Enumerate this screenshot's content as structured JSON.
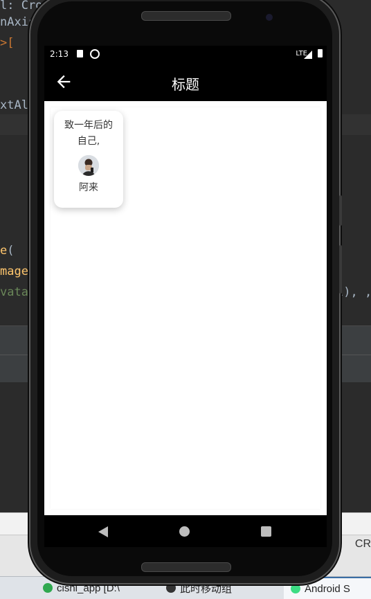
{
  "ide": {
    "code_lines": [
      {
        "parts": [
          {
            "t": "l: CrossAxisAlignment.",
            "c": ""
          }
        ]
      },
      {
        "parts": [
          {
            "t": "nAxisS",
            "c": ""
          }
        ]
      },
      {
        "parts": [
          {
            "t": ">[",
            "c": ""
          }
        ]
      },
      {
        "parts": [
          {
            "t": "xtAli",
            "c": ""
          }
        ]
      },
      {
        "parts": [
          {
            "t": "e",
            "c": "y"
          },
          {
            "t": "(",
            "c": ""
          }
        ]
      },
      {
        "parts": [
          {
            "t": "mage",
            "c": "y"
          },
          {
            "t": "(",
            "c": ""
          }
        ]
      },
      {
        "parts": [
          {
            "t": "vatar",
            "c": "g"
          }
        ]
      }
    ],
    "code_tail": "l), ,",
    "status_right": "CR",
    "taskbar": [
      {
        "label": "cishi_app [D:\\",
        "color": "#2fa84f"
      },
      {
        "label": "此时移动组",
        "color": "#333333"
      },
      {
        "label": "Android S",
        "color": "#3ddc84"
      }
    ]
  },
  "status_bar": {
    "time": "2:13",
    "network": "LTE"
  },
  "app_bar": {
    "title": "标题"
  },
  "card": {
    "text_line1": "致一年后的",
    "text_line2": "自己,",
    "author": "阿来"
  },
  "colors": {
    "app_bar": "#000000",
    "content_bg": "#ffffff",
    "card_text": "#333333"
  }
}
